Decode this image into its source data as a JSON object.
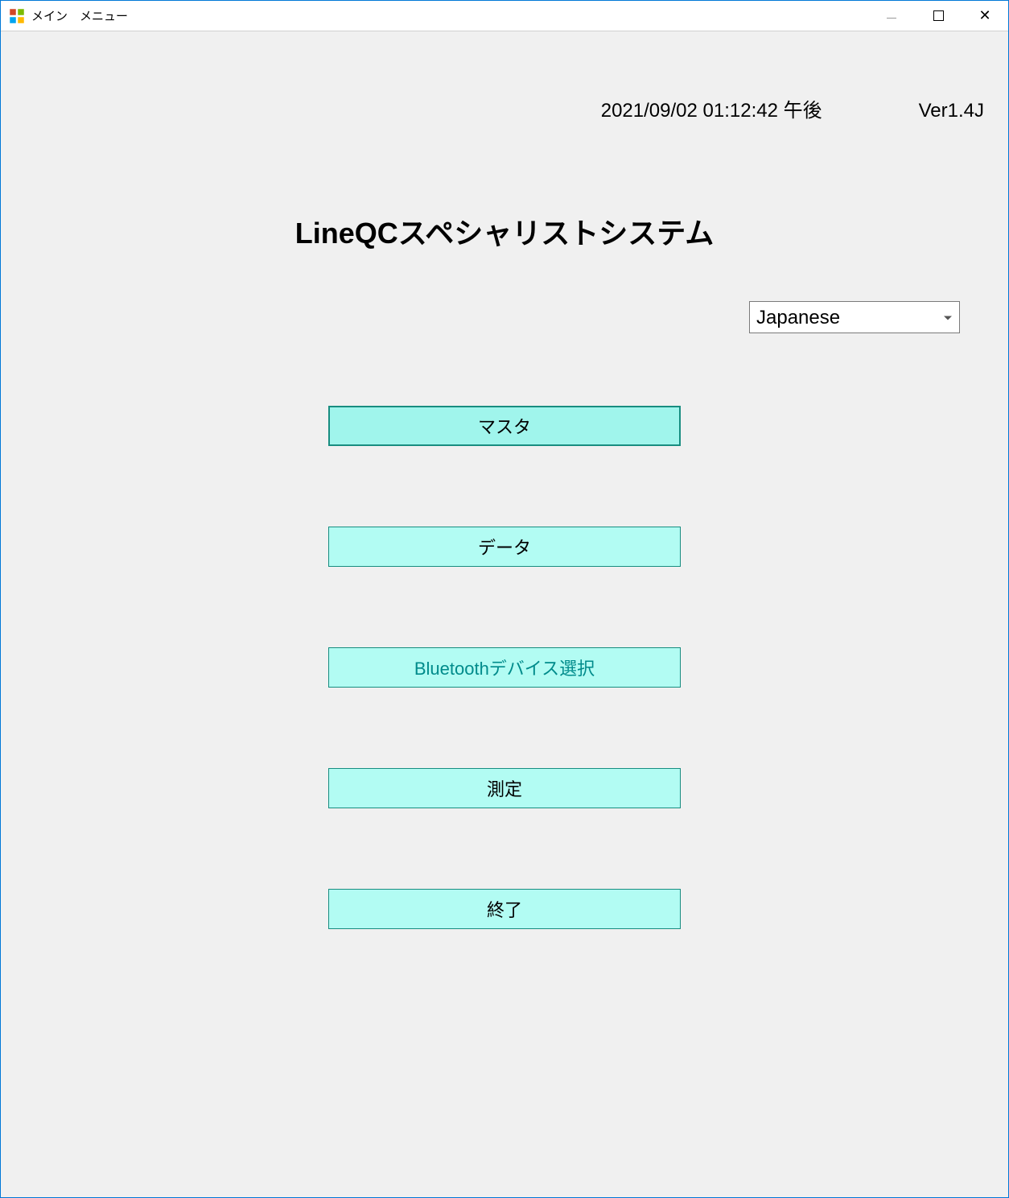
{
  "window": {
    "title": "メイン　メニュー"
  },
  "header": {
    "datetime": "2021/09/02 01:12:42 午後",
    "version": "Ver1.4J"
  },
  "app_title": "LineQCスペシャリストシステム",
  "language": {
    "selected": "Japanese"
  },
  "buttons": {
    "master": "マスタ",
    "data": "データ",
    "bluetooth": "Bluetoothデバイス選択",
    "measure": "測定",
    "exit": "終了"
  }
}
